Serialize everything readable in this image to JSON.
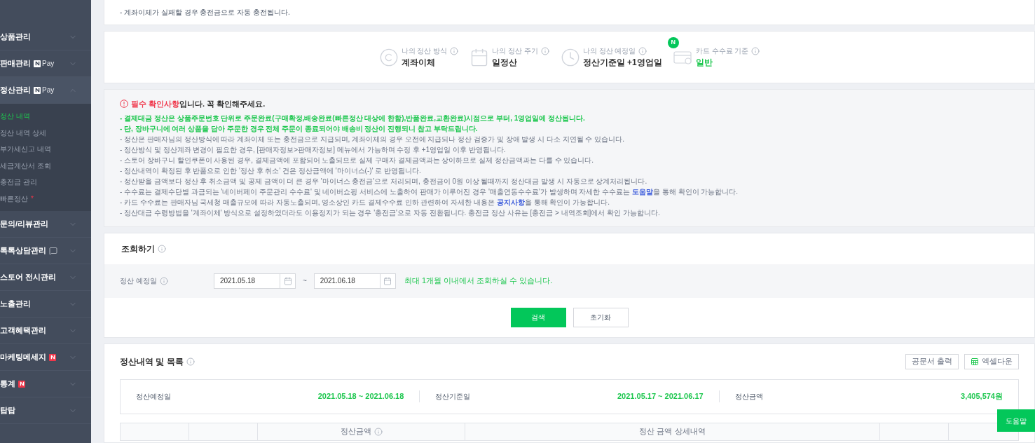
{
  "sidebar": {
    "items": [
      {
        "label": "상품관리",
        "kind": "plain",
        "expanded": false
      },
      {
        "label": "판매관리",
        "kind": "npay",
        "badge_text": "Pay",
        "expanded": false
      },
      {
        "label": "정산관리",
        "kind": "npay",
        "badge_text": "Pay",
        "expanded": true,
        "children": [
          {
            "label": "정산 내역",
            "selected": true
          },
          {
            "label": "정산 내역 상세",
            "selected": false
          },
          {
            "label": "부가세신고 내역",
            "selected": false
          },
          {
            "label": "세금계산서 조회",
            "selected": false
          },
          {
            "label": "충전금 관리",
            "selected": false
          },
          {
            "label": "빠른정산",
            "selected": false,
            "mark": "*"
          }
        ]
      },
      {
        "label": "문의/리뷰관리",
        "kind": "plain",
        "expanded": false
      },
      {
        "label": "톡톡상담관리",
        "kind": "chat",
        "expanded": false
      },
      {
        "label": "스토어 전시관리",
        "kind": "plain",
        "expanded": false
      },
      {
        "label": "노출관리",
        "kind": "plain",
        "expanded": false
      },
      {
        "label": "고객혜택관리",
        "kind": "plain",
        "expanded": false
      },
      {
        "label": "마케팅메세지",
        "kind": "new",
        "expanded": false
      },
      {
        "label": "통계",
        "kind": "new",
        "expanded": false
      },
      {
        "label": "탑탑",
        "kind": "plain",
        "expanded": false
      }
    ]
  },
  "top_note": "- 계좌이체가 실패할 경우 충전금으로 자동 충전됩니다.",
  "settlement_info": [
    {
      "kind": "method",
      "label": "나의 정산 방식",
      "value": "계좌이체",
      "highlight": false
    },
    {
      "kind": "cycle",
      "label": "나의 정산 주기",
      "value": "일정산",
      "highlight": false
    },
    {
      "kind": "date",
      "label": "나의 정산 예정일",
      "value": "정산기준일 +1영업일",
      "highlight": false
    },
    {
      "kind": "card",
      "label": "카드 수수료 기준",
      "value": "일반",
      "highlight": true,
      "badge": "N"
    }
  ],
  "notice": {
    "title_alert": "필수 확인사항",
    "title_rest": "입니다. 꼭 확인해주세요.",
    "lines": [
      {
        "kind": "emphasis",
        "parts": [
          {
            "text": "- 결제대금 정산은 상품주문번호 단위로 주문완료(구매확정,배송완료(빠른정산 대상에 한함),반품완료,교환완료)시점으로 부터, 1영업일에 정산됩니다.",
            "link": false
          }
        ]
      },
      {
        "kind": "emphasis",
        "parts": [
          {
            "text": "- 단, 장바구니에 여러 상품을 담아 주문한 경우 전체 주문이 종료되어야 배송비 정산이 진행되니 참고 부탁드립니다.",
            "link": false
          }
        ]
      },
      {
        "kind": "normal",
        "parts": [
          {
            "text": "- 정산은 판매자님의 정산방식에 따라 계좌이체 또는 충전금으로 지급되며, 계좌이체의 경우 오전에 지급되나 정산 검증가 및 장애 발생 시 다소 지연될 수 있습니다.",
            "link": false
          }
        ]
      },
      {
        "kind": "normal",
        "parts": [
          {
            "text": "- 정산방식 및 정산계좌 변경이 필요한 경우, [판매자정보>판매자정보] 메뉴에서 가능하며 수정 후 +1영업일 이후 반영됩니다.",
            "link": false
          }
        ]
      },
      {
        "kind": "normal",
        "parts": [
          {
            "text": "- 스토어 장바구니 할인쿠폰이 사용된 경우, 결제금액에 포함되어 노출되므로 실제 구매자 결제금액과는 상이하므로 실제 정산금액과는 다를 수 있습니다.",
            "link": false
          }
        ]
      },
      {
        "kind": "normal",
        "parts": [
          {
            "text": "- 정산내역이 확정된 후 반품으로 인한 '정산 후 취소' 건은 정산금액에 '마이너스(-)' 로 반영됩니다.",
            "link": false
          }
        ]
      },
      {
        "kind": "normal",
        "parts": [
          {
            "text": "- 정산받을 금액보다 정산 후 취소금액 및 공제 금액이 더 큰 경우 '마이너스 충전금'으로 처리되며, 충전금이 0원 이상 될때까지 정산대금 발생 시 자동으로 상계처리됩니다.",
            "link": false
          }
        ]
      },
      {
        "kind": "normal",
        "parts": [
          {
            "text": "- 수수료는 결제수단별 과금되는 '네이버페이 주문관리 수수료' 및 네이버쇼핑 서비스에 노출하여 판매가 이루어진 경우 '매출연동수수료'가 발생하며 자세한 수수료는 ",
            "link": false
          },
          {
            "text": "도움말",
            "link": true
          },
          {
            "text": "을 통해 확인이 가능합니다.",
            "link": false
          }
        ]
      },
      {
        "kind": "normal",
        "parts": [
          {
            "text": "- 카드 수수료는 판매자님 국세청 매출규모에 따라 자동노출되며, 영소상인 카드 결제수수료 인하 관련하여 자세한 내용은 ",
            "link": false
          },
          {
            "text": "공지사항",
            "link": true
          },
          {
            "text": "을 통해 확인이 가능합니다.",
            "link": false
          }
        ]
      },
      {
        "kind": "normal",
        "parts": [
          {
            "text": "- 정산대금 수령방법을 '계좌이체' 방식으로 설정하였더라도 이용정지가 되는 경우 '충전금'으로 자동 전환됩니다. 충전금 정산 사유는 [충전금 > 내역조회]에서 확인 가능합니다.",
            "link": false
          }
        ]
      }
    ]
  },
  "search": {
    "title": "조회하기",
    "field_label": "정산 예정일",
    "date_from": "2021.05.18",
    "separator": "~",
    "date_to": "2021.06.18",
    "hint": "최대 1개월 이내에서 조회하실 수 있습니다.",
    "buttons": [
      {
        "kind": "primary",
        "label": "검색"
      },
      {
        "kind": "secondary",
        "label": "초기화"
      }
    ]
  },
  "list": {
    "title": "정산내역 및 목록",
    "buttons": [
      {
        "kind": "plain",
        "label": "공문서 출력"
      },
      {
        "kind": "excel",
        "label": "엑셀다운"
      }
    ],
    "summary": [
      {
        "label": "정산예정일",
        "value": "2021.05.18 ~ 2021.06.18"
      },
      {
        "label": "정산기준일",
        "value": "2021.05.17 ~ 2021.06.17"
      },
      {
        "label": "정산금액",
        "value": "3,405,574원"
      }
    ],
    "columns": [
      {
        "label": "정산금액",
        "info": true
      },
      {
        "label": "정산 금액 상세내역",
        "info": false
      }
    ]
  },
  "help_button": "도움말"
}
